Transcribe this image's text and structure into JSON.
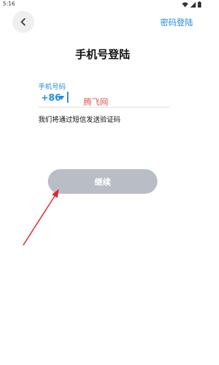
{
  "status_bar": {
    "time": "5:16"
  },
  "header": {
    "password_login": "密码登陆"
  },
  "page": {
    "title": "手机号登陆"
  },
  "phone_field": {
    "label": "手机号码",
    "country_code": "+86",
    "watermark": "腾飞网"
  },
  "hint": "我们将通过短信发送验证码",
  "continue_button": "继续",
  "colors": {
    "accent": "#1e8ae6",
    "button_disabled": "#b9bec6",
    "annotation": "#e0242d"
  },
  "icons": {
    "back": "chevron-left-icon",
    "dropdown": "caret-down-icon",
    "wifi": "wifi-icon",
    "signal": "signal-icon",
    "battery": "battery-icon"
  }
}
